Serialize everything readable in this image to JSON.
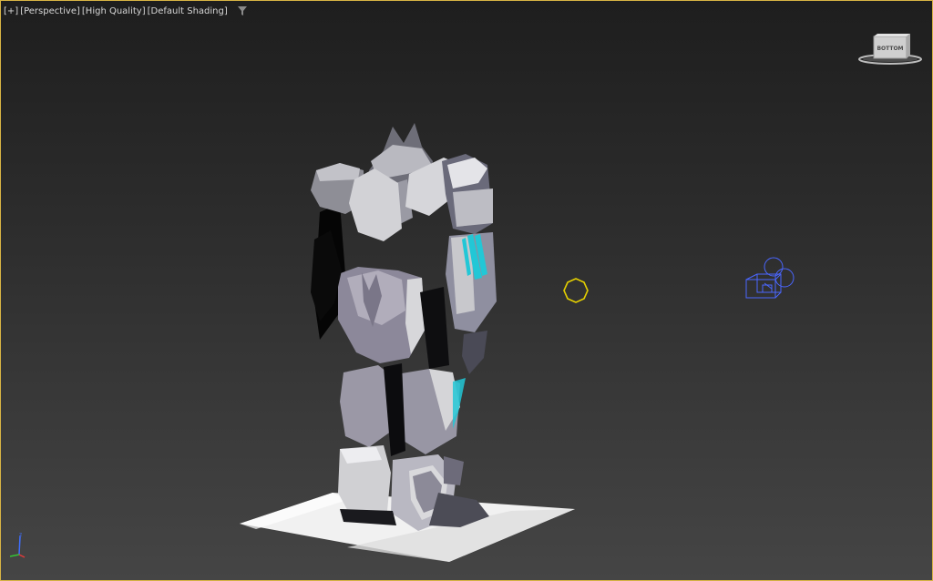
{
  "viewport": {
    "plus_label": "[+]",
    "view_label": "[Perspective]",
    "quality_label": "[High Quality]",
    "shading_label": "[Default Shading]"
  },
  "viewcube": {
    "face_label": "BOTTOM"
  },
  "colors": {
    "active_border": "#d8b444",
    "light_helper": "#e5d000",
    "camera_helper": "#4a66ff",
    "robot_accent": "#22c7d6"
  },
  "icons": {
    "filter": "filter-funnel-icon",
    "light": "omni-light-icon",
    "camera": "camera-icon"
  }
}
